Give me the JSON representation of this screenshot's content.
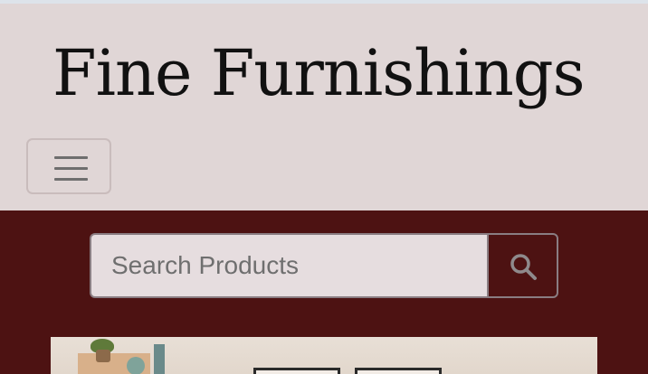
{
  "header": {
    "brand": "Fine Furnishings",
    "menu_icon": "hamburger-menu-icon"
  },
  "search": {
    "placeholder": "Search Products",
    "value": "",
    "button_icon": "search-icon"
  },
  "colors": {
    "header_background": "#e0d6d6",
    "band_background": "#4d1212",
    "input_background": "#e6dddf",
    "brand_text": "#111111"
  }
}
